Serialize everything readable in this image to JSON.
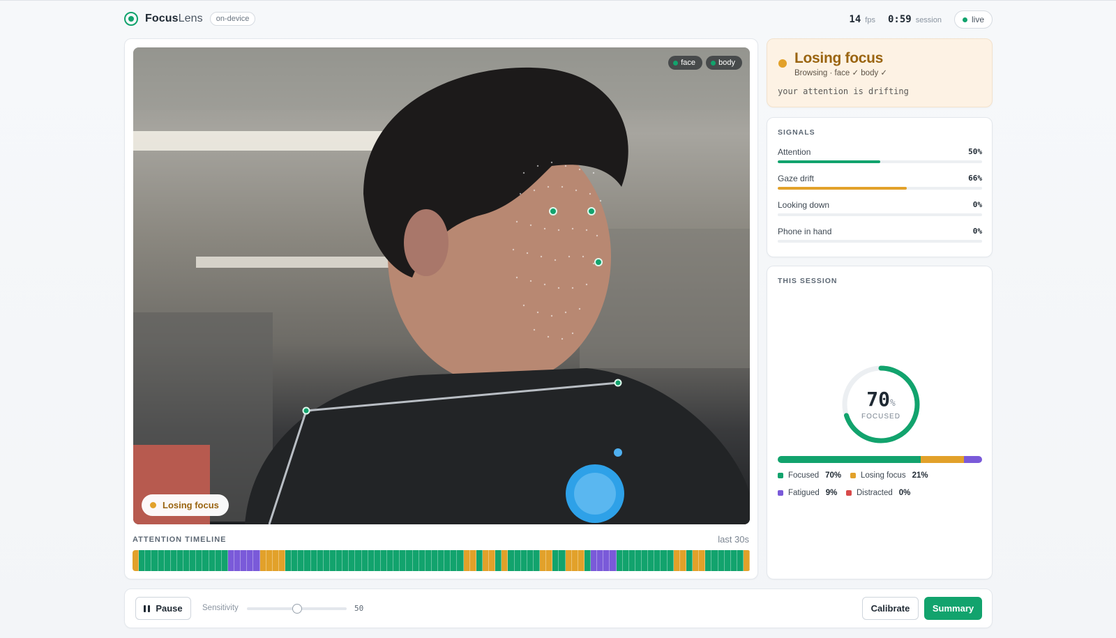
{
  "header": {
    "app_name_bold": "Focus",
    "app_name_light": "Lens",
    "badge": "on-device",
    "fps_value": "14",
    "fps_unit": "fps",
    "session_value": "0:59",
    "session_unit": "session",
    "live_label": "live"
  },
  "video": {
    "chips": [
      {
        "label": "face",
        "icon": "green-dot"
      },
      {
        "label": "body",
        "icon": "green-dot"
      }
    ],
    "state_label": "Losing focus"
  },
  "timeline": {
    "title": "ATTENTION TIMELINE",
    "range": "last 30s",
    "colors": {
      "F": "#12a36d",
      "L": "#e2a12a",
      "T": "#7a5ad9",
      "D": "#d84a4a"
    },
    "segments": [
      [
        "L",
        2
      ],
      [
        "F",
        2
      ],
      [
        "F",
        2
      ],
      [
        "F",
        2
      ],
      [
        "F",
        2
      ],
      [
        "F",
        2
      ],
      [
        "F",
        2
      ],
      [
        "F",
        2
      ],
      [
        "F",
        2
      ],
      [
        "F",
        2
      ],
      [
        "F",
        2
      ],
      [
        "F",
        2
      ],
      [
        "F",
        2
      ],
      [
        "F",
        2
      ],
      [
        "F",
        2
      ],
      [
        "T",
        2
      ],
      [
        "T",
        2
      ],
      [
        "T",
        2
      ],
      [
        "T",
        2
      ],
      [
        "T",
        2
      ],
      [
        "L",
        2
      ],
      [
        "L",
        2
      ],
      [
        "L",
        2
      ],
      [
        "L",
        2
      ],
      [
        "F",
        2
      ],
      [
        "F",
        2
      ],
      [
        "F",
        2
      ],
      [
        "F",
        2
      ],
      [
        "F",
        2
      ],
      [
        "F",
        2
      ],
      [
        "F",
        2
      ],
      [
        "F",
        2
      ],
      [
        "F",
        2
      ],
      [
        "F",
        2
      ],
      [
        "F",
        2
      ],
      [
        "F",
        2
      ],
      [
        "F",
        2
      ],
      [
        "F",
        2
      ],
      [
        "F",
        2
      ],
      [
        "F",
        2
      ],
      [
        "F",
        2
      ],
      [
        "F",
        2
      ],
      [
        "F",
        2
      ],
      [
        "F",
        2
      ],
      [
        "F",
        2
      ],
      [
        "F",
        2
      ],
      [
        "F",
        2
      ],
      [
        "F",
        2
      ],
      [
        "F",
        2
      ],
      [
        "F",
        2
      ],
      [
        "F",
        2
      ],
      [
        "F",
        2
      ],
      [
        "L",
        2
      ],
      [
        "L",
        2
      ],
      [
        "F",
        2
      ],
      [
        "L",
        2
      ],
      [
        "L",
        2
      ],
      [
        "F",
        2
      ],
      [
        "L",
        2
      ],
      [
        "F",
        2
      ],
      [
        "F",
        2
      ],
      [
        "F",
        2
      ],
      [
        "F",
        2
      ],
      [
        "F",
        2
      ],
      [
        "L",
        2
      ],
      [
        "L",
        2
      ],
      [
        "F",
        2
      ],
      [
        "F",
        2
      ],
      [
        "L",
        2
      ],
      [
        "L",
        2
      ],
      [
        "L",
        2
      ],
      [
        "F",
        2
      ],
      [
        "T",
        2
      ],
      [
        "T",
        2
      ],
      [
        "T",
        2
      ],
      [
        "T",
        2
      ],
      [
        "F",
        2
      ],
      [
        "F",
        2
      ],
      [
        "F",
        2
      ],
      [
        "F",
        2
      ],
      [
        "F",
        2
      ],
      [
        "F",
        2
      ],
      [
        "F",
        2
      ],
      [
        "F",
        2
      ],
      [
        "F",
        2
      ],
      [
        "L",
        2
      ],
      [
        "L",
        2
      ],
      [
        "F",
        2
      ],
      [
        "L",
        2
      ],
      [
        "L",
        2
      ],
      [
        "F",
        2
      ],
      [
        "F",
        2
      ],
      [
        "F",
        2
      ],
      [
        "F",
        2
      ],
      [
        "F",
        2
      ],
      [
        "F",
        2
      ],
      [
        "L",
        2
      ]
    ]
  },
  "status": {
    "title": "Losing focus",
    "subtitle": "Browsing · face ✓ body ✓",
    "message": "your attention is drifting"
  },
  "signals": {
    "title": "SIGNALS",
    "items": [
      {
        "label": "Attention",
        "value": "50%",
        "fraction": 0.5,
        "color": "#12a36d"
      },
      {
        "label": "Gaze drift",
        "value": "66%",
        "fraction": 0.63,
        "color": "#e2a12a"
      },
      {
        "label": "Looking down",
        "value": "0%",
        "fraction": 0.0,
        "color": "#12a36d"
      },
      {
        "label": "Phone in hand",
        "value": "0%",
        "fraction": 0.0,
        "color": "#12a36d"
      }
    ]
  },
  "session": {
    "title": "THIS SESSION",
    "focused_value": "70",
    "focused_unit": "%",
    "focused_label": "FOCUSED",
    "focused_fraction": 0.7,
    "breakdown": [
      {
        "label": "Focused",
        "value": "70%",
        "fraction": 0.7,
        "color": "#12a36d"
      },
      {
        "label": "Losing focus",
        "value": "21%",
        "fraction": 0.21,
        "color": "#e2a12a"
      },
      {
        "label": "Fatigued",
        "value": "9%",
        "fraction": 0.09,
        "color": "#7a5ad9"
      },
      {
        "label": "Distracted",
        "value": "0%",
        "fraction": 0.0,
        "color": "#d84a4a"
      }
    ]
  },
  "controls": {
    "pause_label": "Pause",
    "sensitivity_label": "Sensitivity",
    "sensitivity_value": "50",
    "sensitivity_fraction": 0.5,
    "calibrate_label": "Calibrate",
    "summary_label": "Summary"
  }
}
